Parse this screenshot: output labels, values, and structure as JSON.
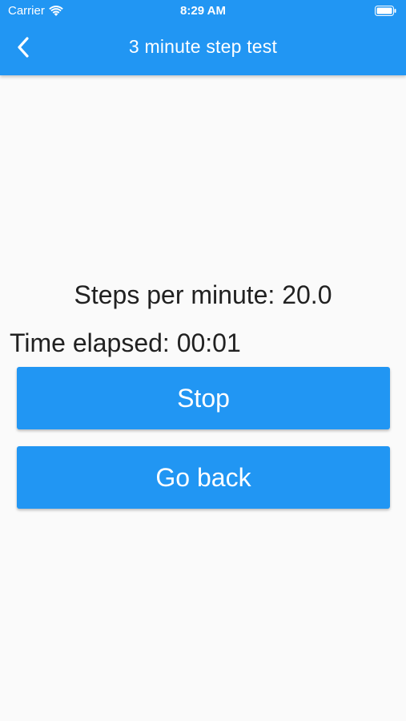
{
  "status_bar": {
    "carrier": "Carrier",
    "time": "8:29 AM",
    "icons": [
      "wifi-icon",
      "battery-icon"
    ]
  },
  "app_bar": {
    "title": "3 minute step test",
    "back_icon": "chevron-left-icon",
    "color": "#2196f3"
  },
  "stats": {
    "steps_per_minute": "Steps per minute: 20.0",
    "time_elapsed": "Time elapsed: 00:01"
  },
  "buttons": {
    "stop_label": "Stop",
    "go_back_label": "Go back"
  },
  "colors": {
    "accent": "#2196f3",
    "background": "#fafafa",
    "text": "#212121"
  }
}
